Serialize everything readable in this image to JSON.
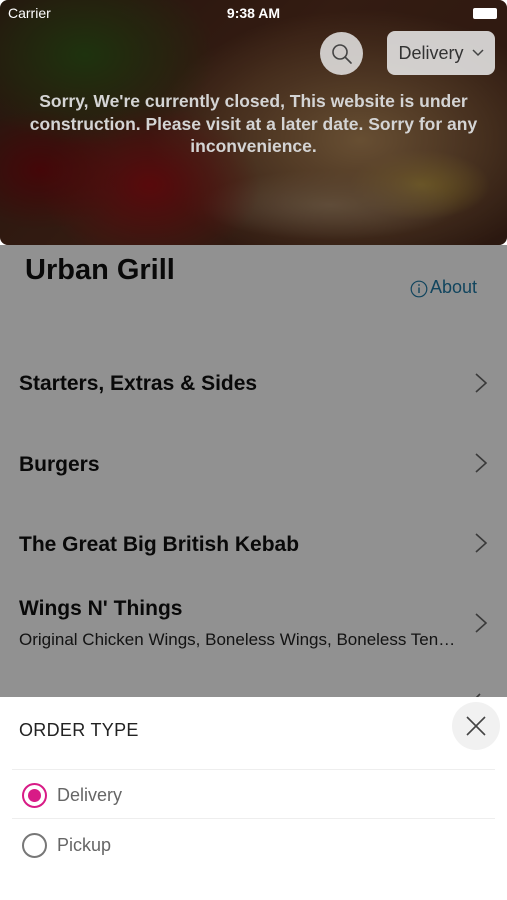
{
  "status_bar": {
    "carrier": "Carrier",
    "time": "9:38 AM"
  },
  "hero": {
    "order_type_selected": "Delivery",
    "closed_message": "Sorry, We're currently closed, This website is under construction. Please visit at a later date. Sorry for any inconvenience."
  },
  "restaurant": {
    "name": "Urban Grill",
    "about_label": "About"
  },
  "categories": [
    {
      "title": "Starters, Extras & Sides",
      "subtitle": ""
    },
    {
      "title": "Burgers",
      "subtitle": ""
    },
    {
      "title": "The Great Big British Kebab",
      "subtitle": ""
    },
    {
      "title": "Wings N' Things",
      "subtitle": "Original Chicken Wings, Boneless Wings, Boneless Ten…"
    }
  ],
  "order_sheet": {
    "title": "ORDER TYPE",
    "options": [
      {
        "label": "Delivery",
        "selected": true
      },
      {
        "label": "Pickup",
        "selected": false
      }
    ]
  },
  "colors": {
    "accent": "#d81b86",
    "link": "#1f7aa6",
    "overlay": "rgba(0,0,0,0.43)"
  },
  "icons": {
    "search": "search-icon",
    "dropdown": "chevron-down-icon",
    "about": "info-icon",
    "category": "chevron-right-icon",
    "close": "close-icon"
  }
}
